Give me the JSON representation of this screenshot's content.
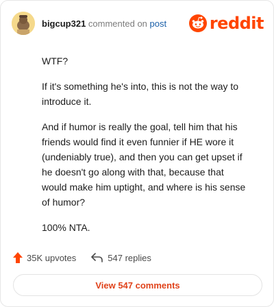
{
  "comment": {
    "username": "bigcup321",
    "action_text": "commented on",
    "post_link": "post",
    "paragraphs": [
      "WTF?",
      "If it's something he's into, this is not the way to introduce it.",
      "And if humor is really the goal, tell him that his friends would find it even funnier if HE wore it (undeniably true), and then you can get upset if he doesn't go along with that, because that would make him uptight, and where is his sense of humor?",
      "100% NTA."
    ]
  },
  "brand": {
    "logo_text": "reddit",
    "color": "#ff4500"
  },
  "stats": {
    "upvotes": "35K upvotes",
    "replies": "547 replies",
    "upvote_color": "#ff4500"
  },
  "actions": {
    "view_comments_label": "View 547 comments"
  }
}
